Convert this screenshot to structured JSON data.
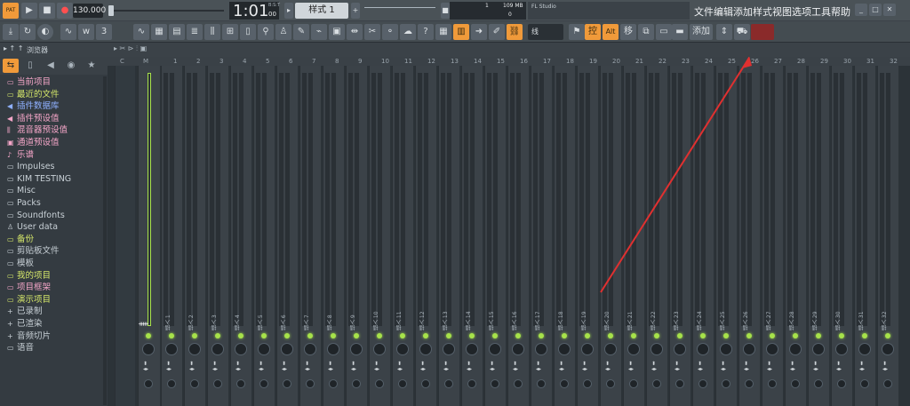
{
  "transport": {
    "pat_label": "PAT",
    "tempo": "130.000",
    "time": "1:01",
    "time_small": "00",
    "bst_label": "B:S:T",
    "pattern": "样式 1"
  },
  "stats": {
    "cpu_value": "1",
    "mem_value": "109 MB",
    "voices_value": "0",
    "app_label": "FL Studio"
  },
  "menu": {
    "items": [
      "文件",
      "编辑",
      "添加",
      "样式",
      "视图",
      "选项",
      "工具",
      "帮助"
    ]
  },
  "toolbar": {
    "snap_label": "线",
    "ctl_label": "控",
    "alt_label": "Alt",
    "move_label": "移",
    "add_label": "添加"
  },
  "browser": {
    "title": "浏览器",
    "items": [
      {
        "label": "当前项目",
        "color": "#f4a6c8",
        "icon": "folder-icon"
      },
      {
        "label": "最近的文件",
        "color": "#d6e86a",
        "icon": "folder-icon"
      },
      {
        "label": "插件数据库",
        "color": "#8fb0ff",
        "icon": "plugin-icon"
      },
      {
        "label": "插件预设值",
        "color": "#f4a6c8",
        "icon": "plugin-icon"
      },
      {
        "label": "混音器预设值",
        "color": "#f4a6c8",
        "icon": "mixer-icon"
      },
      {
        "label": "通道预设值",
        "color": "#f4a6c8",
        "icon": "channel-icon"
      },
      {
        "label": "乐谱",
        "color": "#f4a6c8",
        "icon": "note-icon"
      },
      {
        "label": "Impulses",
        "color": "#c8d0d6",
        "icon": "folder-icon"
      },
      {
        "label": "KIM TESTING",
        "color": "#c8d0d6",
        "icon": "folder-icon"
      },
      {
        "label": "Misc",
        "color": "#c8d0d6",
        "icon": "folder-icon"
      },
      {
        "label": "Packs",
        "color": "#c8d0d6",
        "icon": "folder-icon"
      },
      {
        "label": "Soundfonts",
        "color": "#c8d0d6",
        "icon": "folder-icon"
      },
      {
        "label": "User data",
        "color": "#c8d0d6",
        "icon": "user-icon"
      },
      {
        "label": "备份",
        "color": "#d6e86a",
        "icon": "folder-icon"
      },
      {
        "label": "剪贴板文件",
        "color": "#c8d0d6",
        "icon": "folder-icon"
      },
      {
        "label": "模板",
        "color": "#c8d0d6",
        "icon": "folder-icon"
      },
      {
        "label": "我的项目",
        "color": "#d6e86a",
        "icon": "folder-icon"
      },
      {
        "label": "项目框架",
        "color": "#f4a6c8",
        "icon": "folder-icon"
      },
      {
        "label": "演示项目",
        "color": "#d6e86a",
        "icon": "folder-icon"
      },
      {
        "label": "已录制",
        "color": "#c8d0d6",
        "icon": "plus-icon"
      },
      {
        "label": "已渲染",
        "color": "#c8d0d6",
        "icon": "plus-icon"
      },
      {
        "label": "音频切片",
        "color": "#c8d0d6",
        "icon": "plus-icon"
      },
      {
        "label": "语音",
        "color": "#c8d0d6",
        "icon": "folder-icon"
      }
    ]
  },
  "mixer": {
    "master_label": "M",
    "c_label": "C",
    "strip_prefix": "插入",
    "scale": [
      "3",
      "0",
      "3",
      "6",
      "9",
      "12",
      "15"
    ],
    "channels": [
      "1",
      "2",
      "3",
      "4",
      "5",
      "6",
      "7",
      "8",
      "9",
      "10",
      "11",
      "12",
      "13",
      "14",
      "15",
      "16",
      "17",
      "18",
      "19",
      "20",
      "21",
      "22",
      "23",
      "24",
      "25",
      "26",
      "27",
      "28",
      "29",
      "30",
      "31",
      "32"
    ]
  },
  "colors": {
    "accent": "#f09a3a",
    "led": "#a7e24a",
    "annotation": "#e03030"
  }
}
